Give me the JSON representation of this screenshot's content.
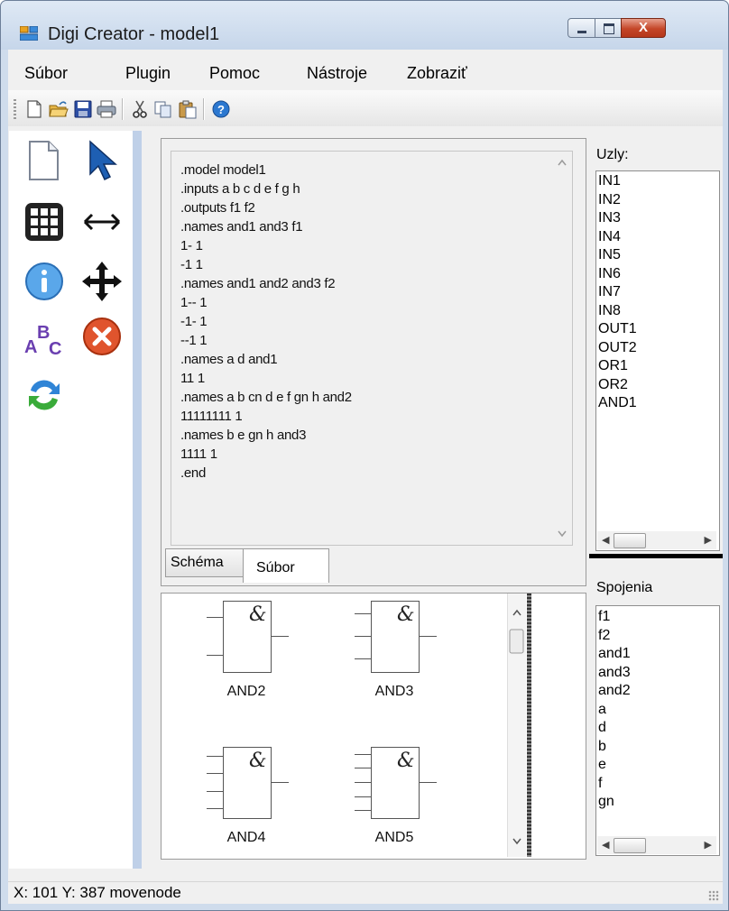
{
  "window": {
    "title": "Digi Creator - model1",
    "close_glyph": "X"
  },
  "menu": [
    {
      "label": "Súbor"
    },
    {
      "label": "Plugin"
    },
    {
      "label": "Pomoc"
    },
    {
      "label": "Nástroje"
    },
    {
      "label": "Zobraziť"
    }
  ],
  "toolbar": [
    "new-icon",
    "open-icon",
    "save-icon",
    "print-icon",
    "cut-icon",
    "copy-icon",
    "paste-icon",
    "help-icon"
  ],
  "tools": [
    "new-document-icon",
    "pointer-icon",
    "grid-icon",
    "horizontal-resize-icon",
    "info-icon",
    "move-icon",
    "abc-label-icon",
    "delete-icon",
    "swap-icon"
  ],
  "editor": {
    "lines": [
      ".model model1",
      ".inputs a b c d e f g h",
      ".outputs f1 f2",
      ".names and1 and3 f1",
      "1- 1",
      "-1 1",
      ".names and1 and2 and3 f2",
      "1-- 1",
      "-1- 1",
      "--1 1",
      ".names a d and1",
      "11 1",
      ".names a b cn d e f gn h and2",
      "11111111 1",
      ".names b e gn h and3",
      "1111 1",
      ".end"
    ]
  },
  "tabs": {
    "schema": "Schéma",
    "subor": "Súbor"
  },
  "gates": [
    {
      "label": "AND2",
      "inputs": 2,
      "symbol": "&"
    },
    {
      "label": "AND3",
      "inputs": 3,
      "symbol": "&"
    },
    {
      "label": "AND4",
      "inputs": 4,
      "symbol": "&"
    },
    {
      "label": "AND5",
      "inputs": 5,
      "symbol": "&"
    }
  ],
  "nodes": {
    "label": "Uzly:",
    "items": [
      "IN1",
      "IN2",
      "IN3",
      "IN4",
      "IN5",
      "IN6",
      "IN7",
      "IN8",
      "OUT1",
      "OUT2",
      "OR1",
      "OR2",
      "AND1"
    ]
  },
  "connections": {
    "label": "Spojenia",
    "items": [
      "f1",
      "f2",
      "and1",
      "and3",
      "and2",
      "a",
      "d",
      "b",
      "e",
      "f",
      "gn"
    ]
  },
  "status": {
    "text": "X: 101 Y: 387  movenode"
  }
}
